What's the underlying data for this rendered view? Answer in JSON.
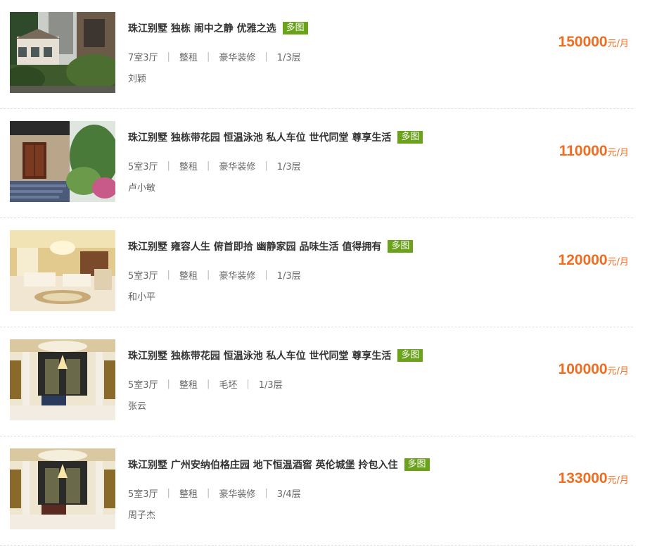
{
  "listings": [
    {
      "title": "珠江别墅 独栋 闹中之静 优雅之选",
      "tag": "多图",
      "layout": "7室3厅",
      "rent_type": "整租",
      "decoration": "豪华装修",
      "floor": "1/3层",
      "agent": "刘颖",
      "price": "150000",
      "price_unit": "元/月",
      "image": "villa-exterior-with-trees"
    },
    {
      "title": "珠江别墅 独栋带花园 恒温泳池 私人车位 世代同堂 尊享生活",
      "tag": "多图",
      "layout": "5室3厅",
      "rent_type": "整租",
      "decoration": "豪华装修",
      "floor": "1/3层",
      "agent": "卢小敏",
      "price": "110000",
      "price_unit": "元/月",
      "image": "villa-entrance-with-steps"
    },
    {
      "title": "珠江别墅 雍容人生 俯首即拾 幽静家园 品味生活 值得拥有",
      "tag": "多图",
      "layout": "5室3厅",
      "rent_type": "整租",
      "decoration": "豪华装修",
      "floor": "1/3层",
      "agent": "和小平",
      "price": "120000",
      "price_unit": "元/月",
      "image": "luxury-living-room"
    },
    {
      "title": "珠江别墅 独栋带花园 恒温泳池 私人车位 世代同堂 尊享生活",
      "tag": "多图",
      "layout": "5室3厅",
      "rent_type": "整租",
      "decoration": "毛坯",
      "floor": "1/3层",
      "agent": "张云",
      "price": "100000",
      "price_unit": "元/月",
      "image": "columned-hall-chandelier"
    },
    {
      "title": "珠江别墅 广州安纳伯格庄园 地下恒温酒窖 英伦城堡 拎包入住",
      "tag": "多图",
      "layout": "5室3厅",
      "rent_type": "整租",
      "decoration": "豪华装修",
      "floor": "3/4层",
      "agent": "周子杰",
      "price": "133000",
      "price_unit": "元/月",
      "image": "columned-hall-chandelier"
    }
  ]
}
